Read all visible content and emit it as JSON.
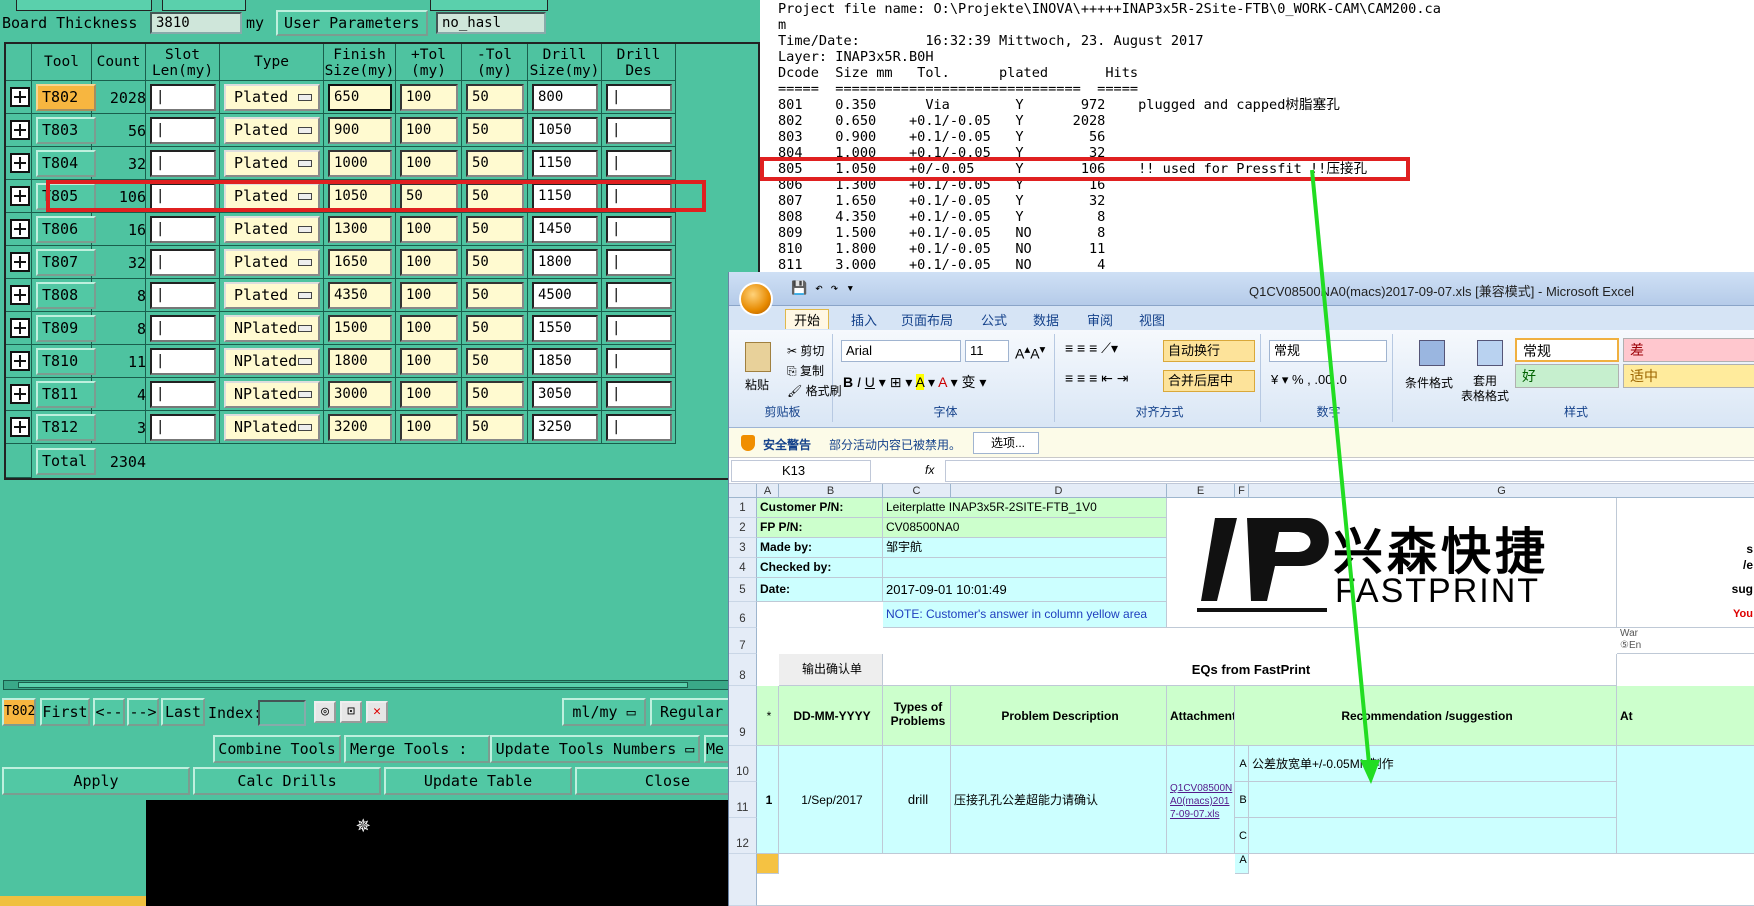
{
  "cam": {
    "board_thickness_label": "Board Thickness :",
    "board_thickness_value": "3810",
    "board_thickness_unit": "my",
    "user_params_label": "User Parameters :",
    "user_params_value": "no_hasl",
    "headers": [
      "Tool",
      "Count",
      "Slot Len(my)",
      "Type",
      "Finish Size(my)",
      "+Tol (my)",
      "-Tol (my)",
      "Drill Size(my)",
      "Drill Des"
    ],
    "rows": [
      {
        "tool": "T802",
        "count": "2028",
        "type": "Plated",
        "finish": "650",
        "ptol": "100",
        "ntol": "50",
        "drill": "800"
      },
      {
        "tool": "T803",
        "count": "56",
        "type": "Plated",
        "finish": "900",
        "ptol": "100",
        "ntol": "50",
        "drill": "1050"
      },
      {
        "tool": "T804",
        "count": "32",
        "type": "Plated",
        "finish": "1000",
        "ptol": "100",
        "ntol": "50",
        "drill": "1150"
      },
      {
        "tool": "T805",
        "count": "106",
        "type": "Plated",
        "finish": "1050",
        "ptol": "50",
        "ntol": "50",
        "drill": "1150"
      },
      {
        "tool": "T806",
        "count": "16",
        "type": "Plated",
        "finish": "1300",
        "ptol": "100",
        "ntol": "50",
        "drill": "1450"
      },
      {
        "tool": "T807",
        "count": "32",
        "type": "Plated",
        "finish": "1650",
        "ptol": "100",
        "ntol": "50",
        "drill": "1800"
      },
      {
        "tool": "T808",
        "count": "8",
        "type": "Plated",
        "finish": "4350",
        "ptol": "100",
        "ntol": "50",
        "drill": "4500"
      },
      {
        "tool": "T809",
        "count": "8",
        "type": "NPlated",
        "finish": "1500",
        "ptol": "100",
        "ntol": "50",
        "drill": "1550"
      },
      {
        "tool": "T810",
        "count": "11",
        "type": "NPlated",
        "finish": "1800",
        "ptol": "100",
        "ntol": "50",
        "drill": "1850"
      },
      {
        "tool": "T811",
        "count": "4",
        "type": "NPlated",
        "finish": "3000",
        "ptol": "100",
        "ntol": "50",
        "drill": "3050"
      },
      {
        "tool": "T812",
        "count": "3",
        "type": "NPlated",
        "finish": "3200",
        "ptol": "100",
        "ntol": "50",
        "drill": "3250"
      }
    ],
    "total_label": "Total",
    "total_count": "2304",
    "nav": {
      "current_tool": "T802",
      "first": "First",
      "prev": "<--",
      "next": "-->",
      "last": "Last",
      "index_label": "Index:",
      "units": "ml/my",
      "mode": "Regular"
    },
    "actions": {
      "combine": "Combine Tools",
      "merge_label": "Merge Tools :",
      "update_numbers": "Update Tools Numbers",
      "more": "Me",
      "apply": "Apply",
      "calc": "Calc Drills",
      "update_table": "Update Table",
      "close": "Close"
    }
  },
  "report": {
    "lines": [
      "Project file name: O:\\Projekte\\INOVA\\+++++INAP3x5R-2Site-FTB\\0_WORK-CAM\\CAM200.ca",
      "m",
      "Time/Date:        16:32:39 Mittwoch, 23. August 2017",
      "Layer: INAP3x5R.B0H",
      "Dcode  Size mm   Tol.      plated       Hits",
      "=====  ==============================  =====",
      "801    0.350      Via        Y       972    plugged and capped树脂塞孔",
      "802    0.650    +0.1/-0.05   Y      2028",
      "803    0.900    +0.1/-0.05   Y        56",
      "804    1.000    +0.1/-0.05   Y        32",
      "805    1.050    +0/-0.05     Y       106    !! used for Pressfit !!压接孔",
      "806    1.300    +0.1/-0.05   Y        16",
      "807    1.650    +0.1/-0.05   Y        32",
      "808    4.350    +0.1/-0.05   Y         8",
      "809    1.500    +0.1/-0.05   NO        8",
      "810    1.800    +0.1/-0.05   NO       11",
      "811    3.000    +0.1/-0.05   NO        4"
    ]
  },
  "excel": {
    "title": "Q1CV08500NA0(macs)2017-09-07.xls  [兼容模式] - Microsoft Excel",
    "tabs": [
      "开始",
      "插入",
      "页面布局",
      "公式",
      "数据",
      "审阅",
      "视图"
    ],
    "clipboard": {
      "paste": "粘贴",
      "cut": "剪切",
      "copy": "复制",
      "format_painter": "格式刷",
      "group": "剪贴板"
    },
    "font": {
      "name": "Arial",
      "size": "11",
      "group": "字体"
    },
    "align": {
      "wrap": "自动换行",
      "merge": "合并后居中",
      "group": "对齐方式"
    },
    "number": {
      "format": "常规",
      "group": "数字"
    },
    "styles": {
      "cond": "条件格式",
      "table": "套用\n表格格式",
      "normal": "常规",
      "bad": "差",
      "good": "好",
      "neutral": "适中",
      "group": "样式"
    },
    "security": {
      "title": "安全警告",
      "msg": "部分活动内容已被禁用。",
      "options": "选项..."
    },
    "namebox": "K13",
    "fx": "fx",
    "cols": [
      "A",
      "B",
      "C",
      "D",
      "E",
      "F",
      "G"
    ],
    "labels": {
      "customer_pn": "Customer P/N:",
      "customer_pn_val": "Leiterplatte INAP3x5R-2SITE-FTB_1V0",
      "fp_pn": "FP P/N:",
      "fp_pn_val": "CV08500NA0",
      "made_by": "Made by:",
      "made_by_val": "邹宇航",
      "checked_by": "Checked by:",
      "date": "Date:",
      "date_val": "2017-09-01 10:01:49",
      "note": "NOTE: Customer's  answer in column yellow area",
      "output_confirm": "输出确认单",
      "eqs": "EQs from FastPrint",
      "star": "*",
      "h_date": "DD-MM-YYYY",
      "h_types": "Types of Problems",
      "h_desc": "Problem Description",
      "h_att": "Attachment",
      "h_rec": "Recommendation /suggestion",
      "h_more": "At",
      "row_no": "1",
      "row_date": "1/Sep/2017",
      "row_type": "drill",
      "row_desc": "压接孔孔公差超能力请确认",
      "row_att": "Q1CV08500NA0(macs)2017-09-07.xls",
      "opt_a": "A",
      "opt_b": "B",
      "opt_c": "C",
      "opt_a2": "A",
      "rec_a": "公差放宽单+/-0.05MM制作",
      "right_s": "s",
      "right_e": "/e",
      "right_sug": "sug",
      "right_you": "You",
      "right_war": "War",
      "right_en": "⑤En"
    },
    "logo": {
      "cn": "兴森快捷",
      "en": "FASTPRINT"
    }
  },
  "colors": {
    "cam_bg": "#4ec3a0",
    "highlight": "#e02020",
    "arrow": "#22dd22",
    "selected_tool": "#f7b640"
  }
}
